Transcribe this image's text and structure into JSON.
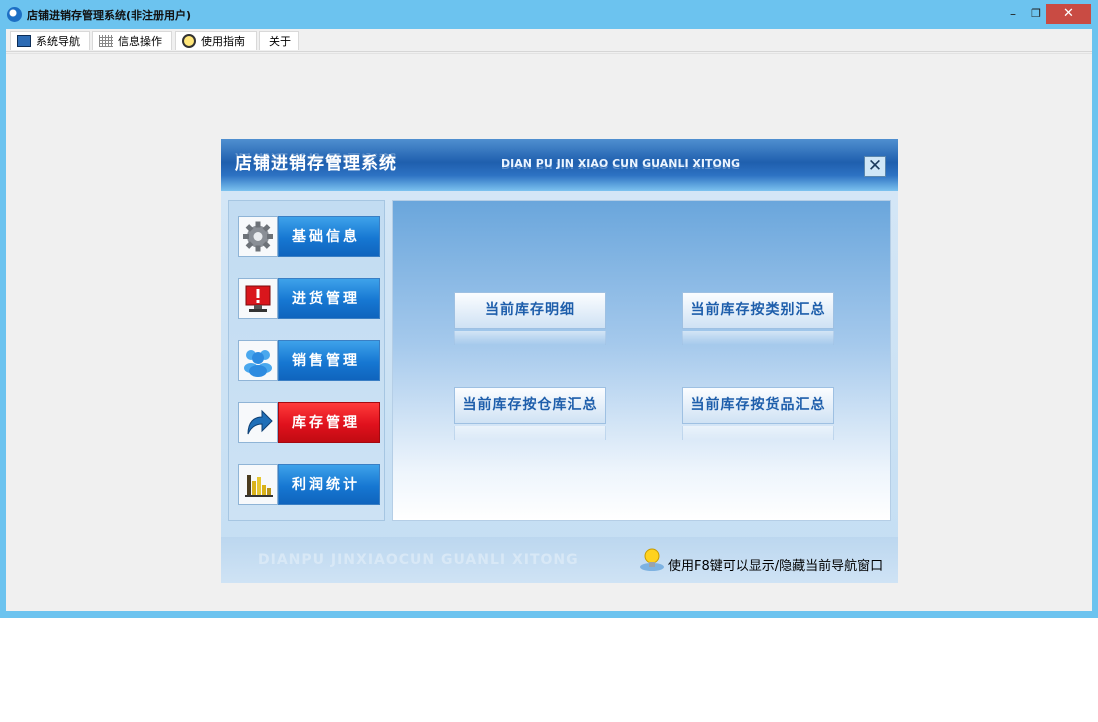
{
  "window": {
    "title": "店铺进销存管理系统(非注册用户)",
    "controls": {
      "minimize": "–",
      "restore": "❐",
      "close": "✕"
    }
  },
  "menu": {
    "items": [
      {
        "label": "系统导航",
        "icon": "monitor-icon"
      },
      {
        "label": "信息操作",
        "icon": "grid-icon"
      },
      {
        "label": "使用指南",
        "icon": "clock-icon"
      },
      {
        "label": "关于"
      }
    ]
  },
  "dialog": {
    "title": "店铺进销存管理系统",
    "subtitle_pinyin": "DIAN PU JIN XIAO CUN GUANLI XITONG",
    "close_glyph": "✕",
    "nav": [
      {
        "label": "基础信息",
        "icon": "gear-icon",
        "active": false
      },
      {
        "label": "进货管理",
        "icon": "monitor-alert-icon",
        "active": false
      },
      {
        "label": "销售管理",
        "icon": "users-icon",
        "active": false
      },
      {
        "label": "库存管理",
        "icon": "arrow-icon",
        "active": true
      },
      {
        "label": "利润统计",
        "icon": "bar-chart-icon",
        "active": false
      }
    ],
    "actions": [
      {
        "label": "当前库存明细"
      },
      {
        "label": "当前库存按类别汇总"
      },
      {
        "label": "当前库存按仓库汇总"
      },
      {
        "label": "当前库存按货品汇总"
      }
    ],
    "footer": {
      "pinyin": "DIANPU JINXIAOCUN GUANLI XITONG",
      "tip": "使用F8键可以显示/隐藏当前导航窗口"
    }
  },
  "colors": {
    "accent_blue": "#1677d2",
    "active_red": "#e0111d",
    "window_frame": "#6cc3ef"
  }
}
